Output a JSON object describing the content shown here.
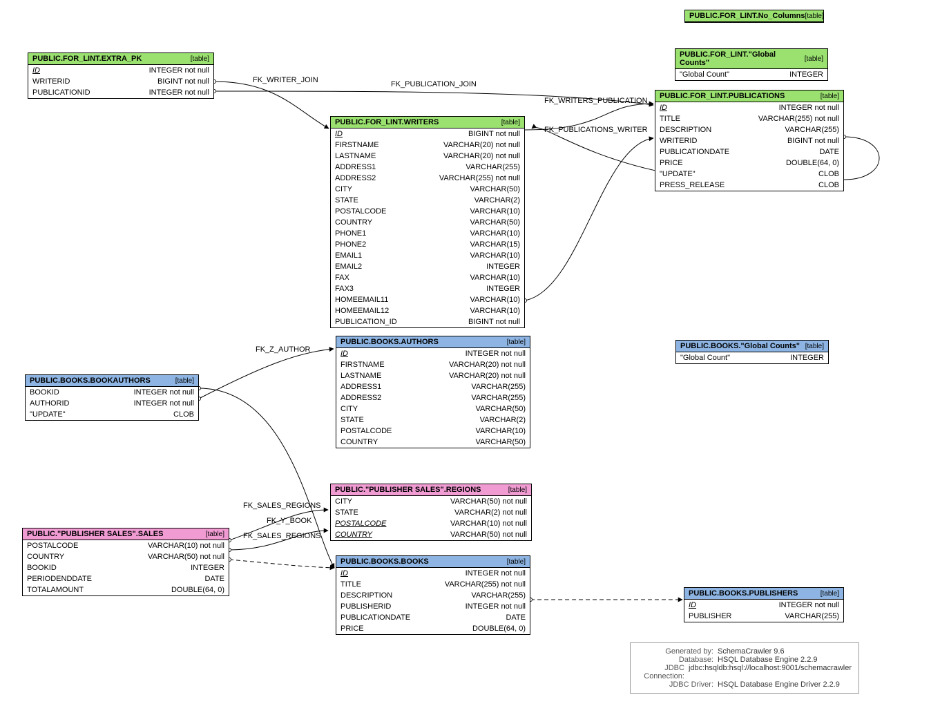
{
  "tag_table": "[table]",
  "colors": {
    "green": "#9AE170",
    "blue": "#8DB4E2",
    "pink": "#F19BD3"
  },
  "tables": {
    "no_columns": {
      "title": "PUBLIC.FOR_LINT.No_Columns"
    },
    "global_lint": {
      "title": "PUBLIC.FOR_LINT.\"Global Counts\""
    },
    "global_books": {
      "title": "PUBLIC.BOOKS.\"Global Counts\""
    },
    "extra_pk": {
      "title": "PUBLIC.FOR_LINT.EXTRA_PK"
    },
    "writers": {
      "title": "PUBLIC.FOR_LINT.WRITERS"
    },
    "publications": {
      "title": "PUBLIC.FOR_LINT.PUBLICATIONS"
    },
    "bookauthors": {
      "title": "PUBLIC.BOOKS.BOOKAUTHORS"
    },
    "authors": {
      "title": "PUBLIC.BOOKS.AUTHORS"
    },
    "regions": {
      "title": "PUBLIC.\"PUBLISHER SALES\".REGIONS"
    },
    "sales": {
      "title": "PUBLIC.\"PUBLISHER SALES\".SALES"
    },
    "books": {
      "title": "PUBLIC.BOOKS.BOOKS"
    },
    "publishers": {
      "title": "PUBLIC.BOOKS.PUBLISHERS"
    }
  },
  "cols": {
    "global_lint": [
      {
        "n": "\"Global Count\"",
        "t": "INTEGER"
      }
    ],
    "global_books": [
      {
        "n": "\"Global Count\"",
        "t": "INTEGER"
      }
    ],
    "extra_pk": [
      {
        "n": "ID",
        "t": "INTEGER not null",
        "pk": true
      },
      {
        "n": "WRITERID",
        "t": "BIGINT not null"
      },
      {
        "n": "PUBLICATIONID",
        "t": "INTEGER not null"
      }
    ],
    "writers": [
      {
        "n": "ID",
        "t": "BIGINT not null",
        "pk": true
      },
      {
        "n": "FIRSTNAME",
        "t": "VARCHAR(20) not null"
      },
      {
        "n": "LASTNAME",
        "t": "VARCHAR(20) not null"
      },
      {
        "n": "ADDRESS1",
        "t": "VARCHAR(255)"
      },
      {
        "n": "ADDRESS2",
        "t": "VARCHAR(255) not null"
      },
      {
        "n": "CITY",
        "t": "VARCHAR(50)"
      },
      {
        "n": "STATE",
        "t": "VARCHAR(2)"
      },
      {
        "n": "POSTALCODE",
        "t": "VARCHAR(10)"
      },
      {
        "n": "COUNTRY",
        "t": "VARCHAR(50)"
      },
      {
        "n": "PHONE1",
        "t": "VARCHAR(10)"
      },
      {
        "n": "PHONE2",
        "t": "VARCHAR(15)"
      },
      {
        "n": "EMAIL1",
        "t": "VARCHAR(10)"
      },
      {
        "n": "EMAIL2",
        "t": "INTEGER"
      },
      {
        "n": "FAX",
        "t": "VARCHAR(10)"
      },
      {
        "n": "FAX3",
        "t": "INTEGER"
      },
      {
        "n": "HOMEEMAIL11",
        "t": "VARCHAR(10)"
      },
      {
        "n": "HOMEEMAIL12",
        "t": "VARCHAR(10)"
      },
      {
        "n": "PUBLICATION_ID",
        "t": "BIGINT not null"
      }
    ],
    "publications": [
      {
        "n": "ID",
        "t": "INTEGER not null",
        "pk": true
      },
      {
        "n": "TITLE",
        "t": "VARCHAR(255) not null"
      },
      {
        "n": "DESCRIPTION",
        "t": "VARCHAR(255)"
      },
      {
        "n": "WRITERID",
        "t": "BIGINT not null"
      },
      {
        "n": "PUBLICATIONDATE",
        "t": "DATE"
      },
      {
        "n": "PRICE",
        "t": "DOUBLE(64, 0)"
      },
      {
        "n": "\"UPDATE\"",
        "t": "CLOB"
      },
      {
        "n": "PRESS_RELEASE",
        "t": "CLOB"
      }
    ],
    "bookauthors": [
      {
        "n": "BOOKID",
        "t": "INTEGER not null"
      },
      {
        "n": "AUTHORID",
        "t": "INTEGER not null"
      },
      {
        "n": "\"UPDATE\"",
        "t": "CLOB"
      }
    ],
    "authors": [
      {
        "n": "ID",
        "t": "INTEGER not null",
        "pk": true
      },
      {
        "n": "FIRSTNAME",
        "t": "VARCHAR(20) not null"
      },
      {
        "n": "LASTNAME",
        "t": "VARCHAR(20) not null"
      },
      {
        "n": "ADDRESS1",
        "t": "VARCHAR(255)"
      },
      {
        "n": "ADDRESS2",
        "t": "VARCHAR(255)"
      },
      {
        "n": "CITY",
        "t": "VARCHAR(50)"
      },
      {
        "n": "STATE",
        "t": "VARCHAR(2)"
      },
      {
        "n": "POSTALCODE",
        "t": "VARCHAR(10)"
      },
      {
        "n": "COUNTRY",
        "t": "VARCHAR(50)"
      }
    ],
    "regions": [
      {
        "n": "CITY",
        "t": "VARCHAR(50) not null"
      },
      {
        "n": "STATE",
        "t": "VARCHAR(2) not null"
      },
      {
        "n": "POSTALCODE",
        "t": "VARCHAR(10) not null",
        "pk": true
      },
      {
        "n": "COUNTRY",
        "t": "VARCHAR(50) not null",
        "pk": true
      }
    ],
    "sales": [
      {
        "n": "POSTALCODE",
        "t": "VARCHAR(10) not null"
      },
      {
        "n": "COUNTRY",
        "t": "VARCHAR(50) not null"
      },
      {
        "n": "BOOKID",
        "t": "INTEGER"
      },
      {
        "n": "PERIODENDDATE",
        "t": "DATE"
      },
      {
        "n": "TOTALAMOUNT",
        "t": "DOUBLE(64, 0)"
      }
    ],
    "books": [
      {
        "n": "ID",
        "t": "INTEGER not null",
        "pk": true
      },
      {
        "n": "TITLE",
        "t": "VARCHAR(255) not null"
      },
      {
        "n": "DESCRIPTION",
        "t": "VARCHAR(255)"
      },
      {
        "n": "PUBLISHERID",
        "t": "INTEGER not null"
      },
      {
        "n": "PUBLICATIONDATE",
        "t": "DATE"
      },
      {
        "n": "PRICE",
        "t": "DOUBLE(64, 0)"
      }
    ],
    "publishers": [
      {
        "n": "ID",
        "t": "INTEGER not null",
        "pk": true
      },
      {
        "n": "PUBLISHER",
        "t": "VARCHAR(255)"
      }
    ]
  },
  "edges": {
    "fk_writer_join": "FK_WRITER_JOIN",
    "fk_publication_join": "FK_PUBLICATION_JOIN",
    "fk_writers_publication": "FK_WRITERS_PUBLICATION",
    "fk_publications_writer": "FK_PUBLICATIONS_WRITER",
    "fk_z_author": "FK_Z_AUTHOR",
    "fk_sales_regions": "FK_SALES_REGIONS",
    "fk_y_book": "FK_Y_BOOK",
    "fk_sales_regions2": "FK_SALES_REGIONS"
  },
  "footer": {
    "k1": "Generated by:",
    "v1": "SchemaCrawler 9.6",
    "k2": "Database:",
    "v2": "HSQL Database Engine  2.2.9",
    "k3": "JDBC Connection:",
    "v3": "jdbc:hsqldb:hsql://localhost:9001/schemacrawler",
    "k4": "JDBC Driver:",
    "v4": "HSQL Database Engine Driver  2.2.9"
  }
}
